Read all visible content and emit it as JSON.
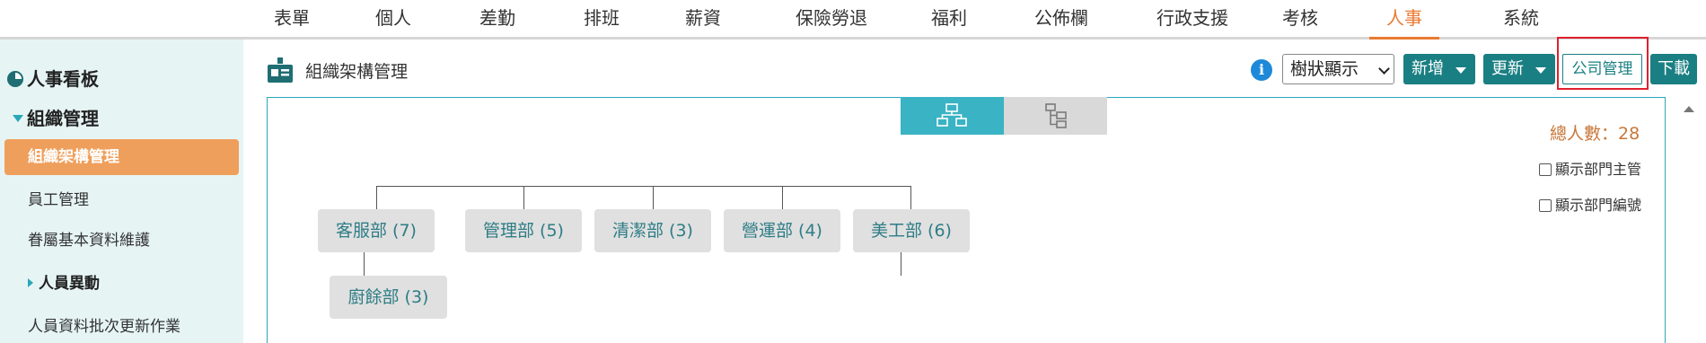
{
  "topnav": {
    "tabs": [
      "表單",
      "個人",
      "差勤",
      "排班",
      "薪資",
      "保險勞退",
      "福利",
      "公佈欄",
      "行政支援",
      "考核",
      "人事",
      "系統"
    ],
    "active_index": 10
  },
  "sidebar": {
    "board": "人事看板",
    "group": "組織管理",
    "active_item": "組織架構管理",
    "items": [
      "員工管理",
      "眷屬基本資料維護"
    ],
    "sub_group": "人員異動",
    "last_item": "人員資料批次更新作業"
  },
  "header": {
    "title": "組織架構管理",
    "info_icon": "i",
    "view_select": "樹狀顯示",
    "add_label": "新增",
    "update_label": "更新",
    "company_label": "公司管理",
    "download_label": "下載"
  },
  "panel": {
    "total_label": "總人數：28",
    "checkbox_managers": "顯示部門主管",
    "checkbox_codes": "顯示部門編號",
    "departments": [
      "客服部 (7)",
      "管理部 (5)",
      "清潔部 (3)",
      "營運部 (4)",
      "美工部 (6)",
      "廚餘部 (3)"
    ]
  },
  "colors": {
    "accent_orange": "#e97a32",
    "active_sidebar": "#ef9f5c",
    "teal_button": "#1a7f82",
    "toggle_active": "#3ab3c4",
    "highlight_red": "#e0202e",
    "sidebar_bg": "#e6f4f4"
  },
  "icons": [
    "pie-chart-icon",
    "triangle-down-icon",
    "triangle-right-icon",
    "org-chart-icon",
    "info-icon",
    "hierarchy-icon",
    "tree-icon",
    "caret-down-icon",
    "scroll-up-icon"
  ]
}
